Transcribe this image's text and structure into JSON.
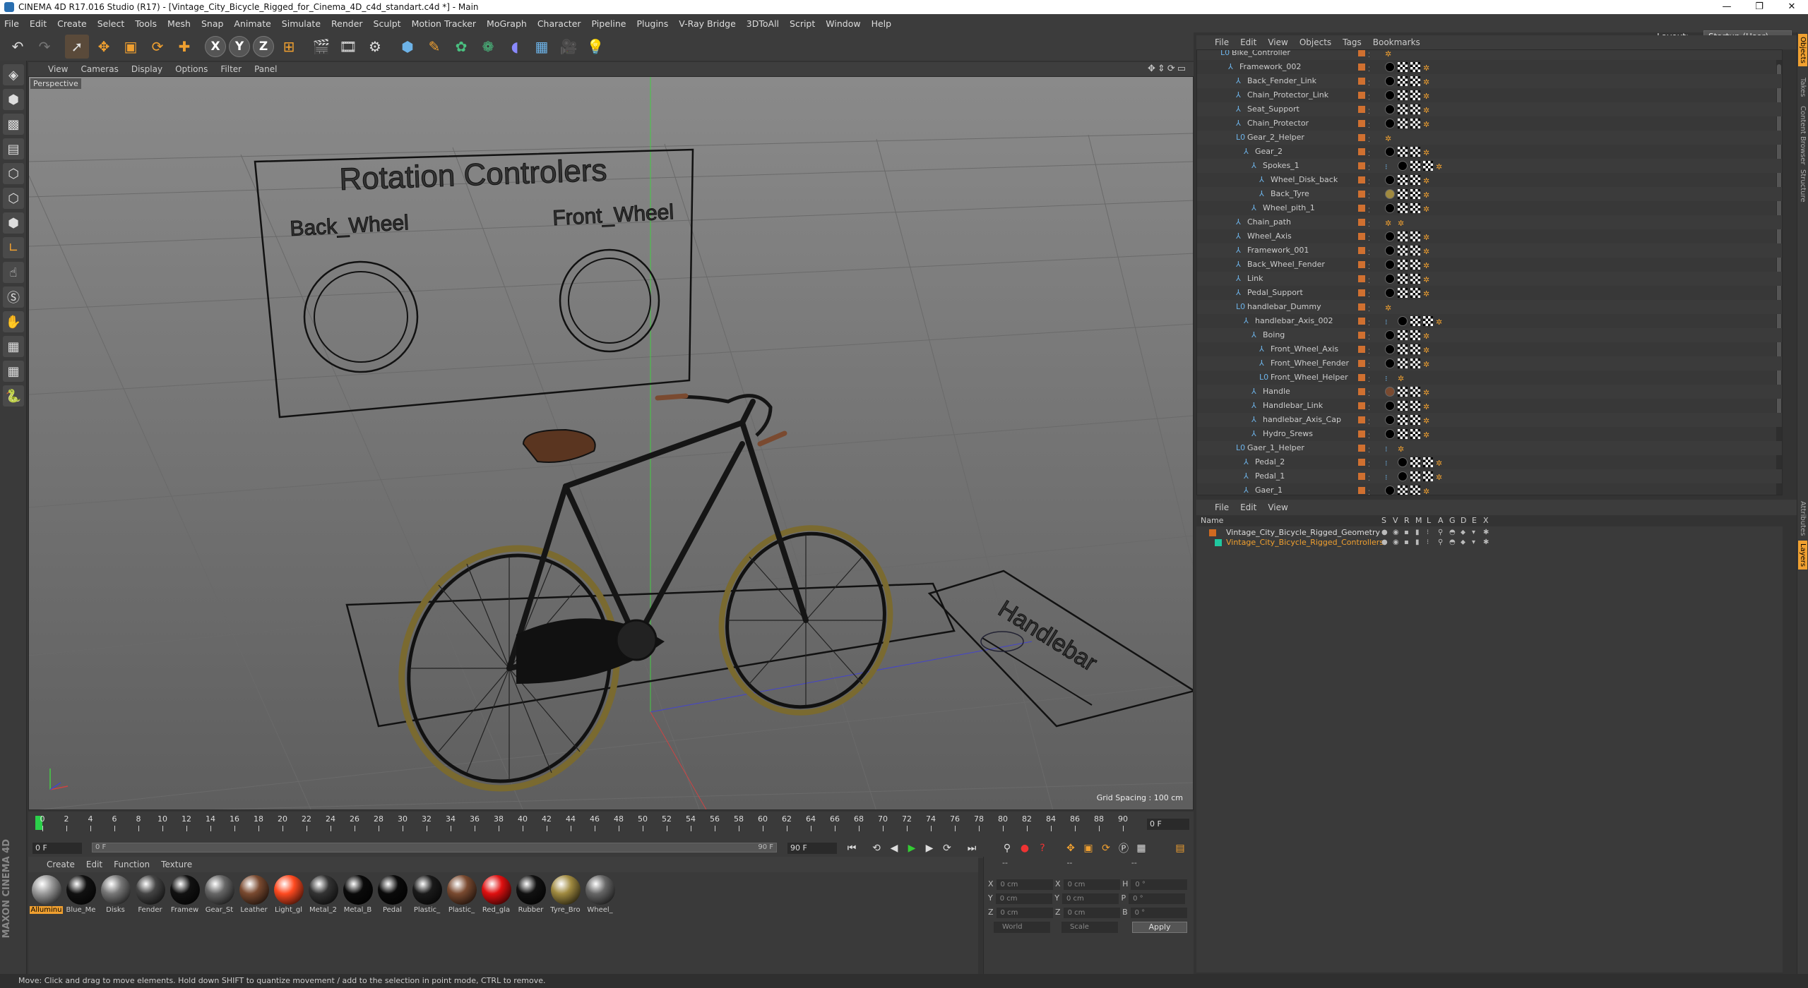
{
  "window": {
    "title": "CINEMA 4D R17.016 Studio (R17) - [Vintage_City_Bicycle_Rigged_for_Cinema_4D_c4d_standart.c4d *] - Main",
    "controls": [
      "—",
      "❐",
      "✕"
    ]
  },
  "menubar": {
    "items": [
      "File",
      "Edit",
      "Create",
      "Select",
      "Tools",
      "Mesh",
      "Snap",
      "Animate",
      "Simulate",
      "Render",
      "Sculpt",
      "Motion Tracker",
      "MoGraph",
      "Character",
      "Pipeline",
      "Plugins",
      "V-Ray Bridge",
      "3DToAll",
      "Script",
      "Window",
      "Help"
    ],
    "layout_label": "Layout:",
    "layout_value": "Startup (User)"
  },
  "toolbar": {
    "icons": [
      "undo-icon",
      "redo-icon",
      "select-arrow-icon",
      "move-icon",
      "scale-icon",
      "rotate-icon",
      "create-icon",
      "x-axis-icon",
      "y-axis-icon",
      "z-axis-icon",
      "coord-system-icon",
      "render-view-icon",
      "render-pv-icon",
      "render-settings-icon",
      "cube-icon",
      "pen-icon",
      "subdivision-icon",
      "cloner-icon",
      "deformer-icon",
      "floor-icon",
      "camera-icon",
      "light-icon"
    ],
    "axis_labels": {
      "x": "X",
      "y": "Y",
      "z": "Z"
    }
  },
  "viewport": {
    "menu": [
      "View",
      "Cameras",
      "Display",
      "Options",
      "Filter",
      "Panel"
    ],
    "label": "Perspective",
    "grid_spacing": "Grid Spacing : 100 cm",
    "scene_text": {
      "rotation_title": "Rotation Controlers",
      "back_wheel": "Back_Wheel",
      "front_wheel": "Front_Wheel",
      "handlebar": "Handlebar"
    }
  },
  "timeline": {
    "ticks": [
      "0",
      "2",
      "4",
      "6",
      "8",
      "10",
      "12",
      "14",
      "16",
      "18",
      "20",
      "22",
      "24",
      "26",
      "28",
      "30",
      "32",
      "34",
      "36",
      "38",
      "40",
      "42",
      "44",
      "46",
      "48",
      "50",
      "52",
      "54",
      "56",
      "58",
      "60",
      "62",
      "64",
      "66",
      "68",
      "70",
      "72",
      "74",
      "76",
      "78",
      "80",
      "82",
      "84",
      "86",
      "88",
      "90"
    ],
    "current_frame": "0 F",
    "start_field": "0 F",
    "slider_left": "0 F",
    "slider_right": "90 F",
    "end_field": "90 F"
  },
  "material_manager": {
    "menu": [
      "Create",
      "Edit",
      "Function",
      "Texture"
    ],
    "materials": [
      {
        "name": "Alluminu",
        "color": "#9a9a9a",
        "selected": true
      },
      {
        "name": "Blue_Me",
        "color": "#111",
        "selected": false
      },
      {
        "name": "Disks",
        "color": "#777",
        "selected": false
      },
      {
        "name": "Fender",
        "color": "#444",
        "selected": false
      },
      {
        "name": "Framew",
        "color": "#111",
        "selected": false
      },
      {
        "name": "Gear_St",
        "color": "#666",
        "selected": false
      },
      {
        "name": "Leather",
        "color": "#7a4a30",
        "selected": false
      },
      {
        "name": "Light_gl",
        "color": "#ff4a20",
        "selected": false
      },
      {
        "name": "Metal_2",
        "color": "#333",
        "selected": false
      },
      {
        "name": "Metal_B",
        "color": "#0a0a0a",
        "selected": false
      },
      {
        "name": "Pedal",
        "color": "#0a0a0a",
        "selected": false
      },
      {
        "name": "Plastic_",
        "color": "#1a1a1a",
        "selected": false
      },
      {
        "name": "Plastic_",
        "color": "#7a4a30",
        "selected": false
      },
      {
        "name": "Red_gla",
        "color": "#e01010",
        "selected": false
      },
      {
        "name": "Rubber",
        "color": "#111",
        "selected": false
      },
      {
        "name": "Tyre_Bro",
        "color": "#a08a40",
        "selected": false
      },
      {
        "name": "Wheel_",
        "color": "#666",
        "selected": false
      }
    ]
  },
  "coordinates": {
    "pos_labels": [
      "X",
      "Y",
      "Z"
    ],
    "size_labels": [
      "X",
      "Y",
      "Z"
    ],
    "rot_labels": [
      "H",
      "P",
      "B"
    ],
    "zero_cm": "0 cm",
    "zero_deg": "0 °",
    "world": "World",
    "scale": "Scale",
    "apply": "Apply",
    "dashes": "--"
  },
  "object_manager": {
    "menu": [
      "File",
      "Edit",
      "View",
      "Objects",
      "Tags",
      "Bookmarks"
    ],
    "items": [
      {
        "name": "Bike_Controller",
        "indent": 1,
        "type": "null"
      },
      {
        "name": "Framework_002",
        "indent": 2,
        "type": "bone",
        "tags": "bcc"
      },
      {
        "name": "Back_Fender_Link",
        "indent": 3,
        "type": "bone",
        "tags": "bcc"
      },
      {
        "name": "Chain_Protector_Link",
        "indent": 3,
        "type": "bone",
        "tags": "bcc"
      },
      {
        "name": "Seat_Support",
        "indent": 3,
        "type": "bone",
        "tags": "bcc"
      },
      {
        "name": "Chain_Protector",
        "indent": 3,
        "type": "bone",
        "tags": "bcc"
      },
      {
        "name": "Gear_2_Helper",
        "indent": 3,
        "type": "null",
        "tags": ""
      },
      {
        "name": "Gear_2",
        "indent": 4,
        "type": "bone",
        "tags": "bcc"
      },
      {
        "name": "Spokes_1",
        "indent": 5,
        "type": "bone",
        "tags": "dbcc"
      },
      {
        "name": "Wheel_Disk_back",
        "indent": 6,
        "type": "bone",
        "tags": "bcc"
      },
      {
        "name": "Back_Tyre",
        "indent": 6,
        "type": "bone",
        "tags": "ycc"
      },
      {
        "name": "Wheel_pith_1",
        "indent": 5,
        "type": "bone",
        "tags": "bcc"
      },
      {
        "name": "Chain_path",
        "indent": 3,
        "type": "bone",
        "tags": "o"
      },
      {
        "name": "Wheel_Axis",
        "indent": 3,
        "type": "bone",
        "tags": "bcc"
      },
      {
        "name": "Framework_001",
        "indent": 3,
        "type": "bone",
        "tags": "bcc"
      },
      {
        "name": "Back_Wheel_Fender",
        "indent": 3,
        "type": "bone",
        "tags": "bcc"
      },
      {
        "name": "Link",
        "indent": 3,
        "type": "bone",
        "tags": "bcc"
      },
      {
        "name": "Pedal_Support",
        "indent": 3,
        "type": "bone",
        "tags": "bcc"
      },
      {
        "name": "handlebar_Dummy",
        "indent": 3,
        "type": "null",
        "tags": ""
      },
      {
        "name": "handlebar_Axis_002",
        "indent": 4,
        "type": "bone",
        "tags": "dbcc"
      },
      {
        "name": "Boing",
        "indent": 5,
        "type": "bone",
        "tags": "bcc"
      },
      {
        "name": "Front_Wheel_Axis",
        "indent": 6,
        "type": "bone",
        "tags": "bcc"
      },
      {
        "name": "Front_Wheel_Fender",
        "indent": 6,
        "type": "bone",
        "tags": "bcc"
      },
      {
        "name": "Front_Wheel_Helper",
        "indent": 6,
        "type": "null",
        "tags": "d"
      },
      {
        "name": "Handle",
        "indent": 5,
        "type": "bone",
        "tags": "rcc"
      },
      {
        "name": "Handlebar_Link",
        "indent": 5,
        "type": "bone",
        "tags": "bcc"
      },
      {
        "name": "handlebar_Axis_Cap",
        "indent": 5,
        "type": "bone",
        "tags": "bcc"
      },
      {
        "name": "Hydro_Srews",
        "indent": 5,
        "type": "bone",
        "tags": "bcc"
      },
      {
        "name": "Gaer_1_Helper",
        "indent": 3,
        "type": "null",
        "tags": "d"
      },
      {
        "name": "Pedal_2",
        "indent": 4,
        "type": "bone",
        "tags": "dbcc"
      },
      {
        "name": "Pedal_1",
        "indent": 4,
        "type": "bone",
        "tags": "dbcc"
      },
      {
        "name": "Gaer_1",
        "indent": 4,
        "type": "bone",
        "tags": "bcc"
      }
    ]
  },
  "layer_manager": {
    "menu": [
      "File",
      "Edit",
      "View"
    ],
    "header_name": "Name",
    "header_cols": [
      "S",
      "V",
      "R",
      "M",
      "L",
      "A",
      "G",
      "D",
      "E",
      "X"
    ],
    "layers": [
      {
        "name": "Vintage_City_Bicycle_Rigged_Geometry",
        "color": "#d06a20",
        "text_color": "#ddd"
      },
      {
        "name": "Vintage_City_Bicycle_Rigged_Controllers",
        "color": "#20c8a0",
        "text_color": "#f0a030"
      }
    ]
  },
  "right_tabs": [
    "Objects",
    "Takes",
    "Content Browser",
    "Structure",
    "Attributes",
    "Layers"
  ],
  "status": "Move: Click and drag to move elements. Hold down SHIFT to quantize movement / add to the selection in point mode, CTRL to remove.",
  "maxon": "MAXON CINEMA 4D",
  "colors": {
    "accent": "#f0a030",
    "panel": "#3a3a3a",
    "viewport": "#777777"
  }
}
